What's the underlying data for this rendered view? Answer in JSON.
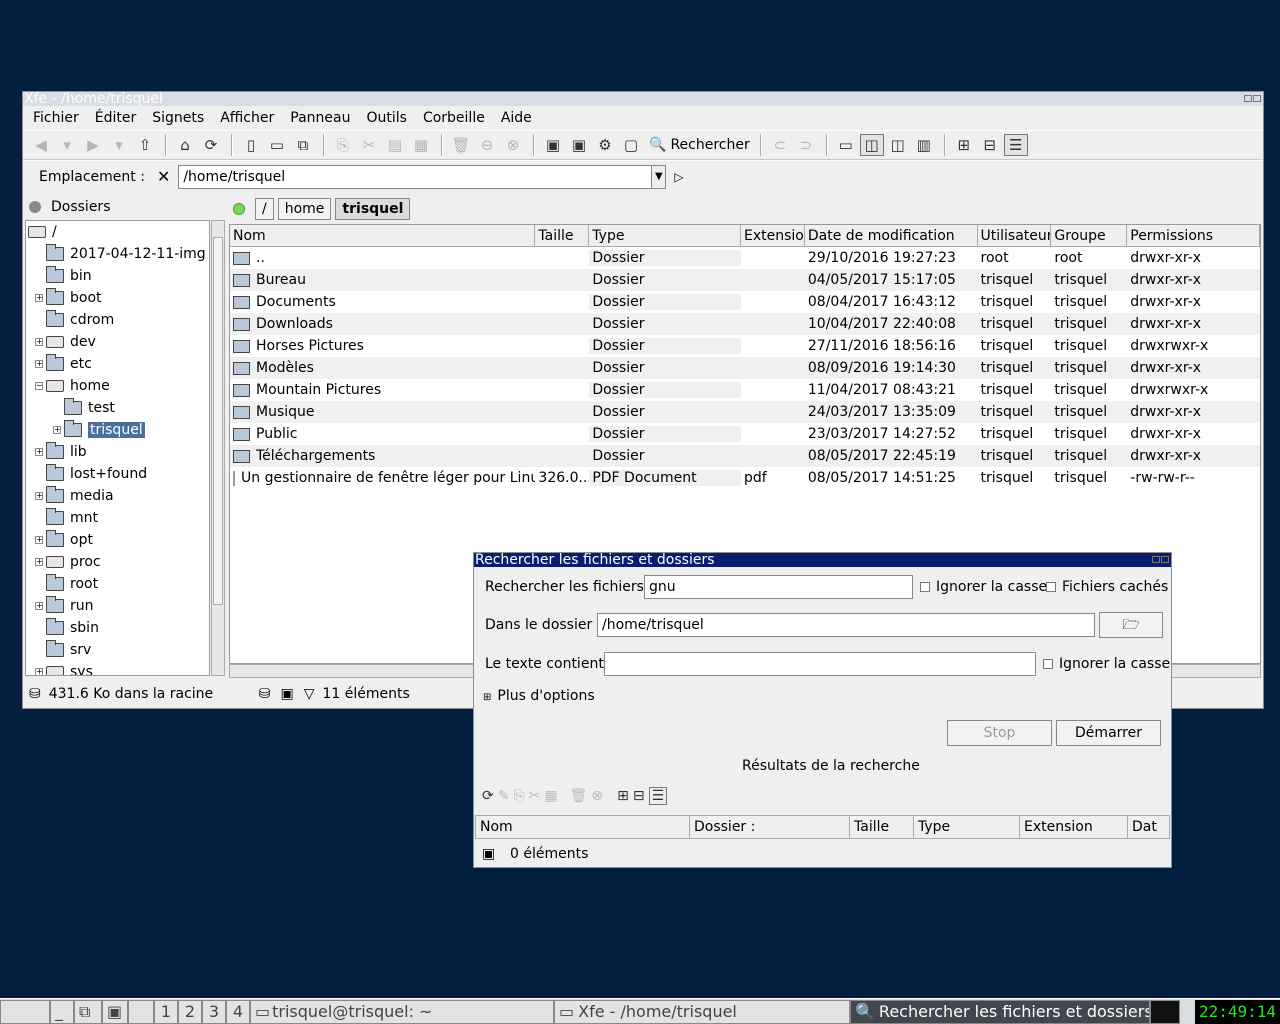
{
  "xfe": {
    "title": "Xfe - /home/trisquel",
    "menu": [
      "Fichier",
      "Éditer",
      "Signets",
      "Afficher",
      "Panneau",
      "Outils",
      "Corbeille",
      "Aide"
    ],
    "search_button": "Rechercher",
    "location_label": "Emplacement :",
    "location_value": "/home/trisquel",
    "folders_label": "Dossiers",
    "tree": [
      {
        "label": "/",
        "icon": "drive-icon",
        "expander": ""
      },
      {
        "label": "2017-04-12-11-img",
        "icon": "folder-icon",
        "expander": ""
      },
      {
        "label": "bin",
        "icon": "folder-icon",
        "expander": ""
      },
      {
        "label": "boot",
        "icon": "folder-icon",
        "expander": "+"
      },
      {
        "label": "cdrom",
        "icon": "folder-icon",
        "expander": ""
      },
      {
        "label": "dev",
        "icon": "drive-icon",
        "expander": "+"
      },
      {
        "label": "etc",
        "icon": "folder-icon",
        "expander": "+"
      },
      {
        "label": "home",
        "icon": "drive-icon",
        "expander": "−"
      },
      {
        "label": "test",
        "icon": "folder-icon",
        "expander": ""
      },
      {
        "label": "trisquel",
        "icon": "folder-icon",
        "expander": "+"
      },
      {
        "label": "lib",
        "icon": "folder-icon",
        "expander": "+"
      },
      {
        "label": "lost+found",
        "icon": "locked-folder-icon",
        "expander": ""
      },
      {
        "label": "media",
        "icon": "folder-icon",
        "expander": "+"
      },
      {
        "label": "mnt",
        "icon": "folder-icon",
        "expander": ""
      },
      {
        "label": "opt",
        "icon": "folder-icon",
        "expander": "+"
      },
      {
        "label": "proc",
        "icon": "drive-icon",
        "expander": "+"
      },
      {
        "label": "root",
        "icon": "locked-folder-icon",
        "expander": ""
      },
      {
        "label": "run",
        "icon": "folder-icon",
        "expander": "+"
      },
      {
        "label": "sbin",
        "icon": "folder-icon",
        "expander": ""
      },
      {
        "label": "srv",
        "icon": "folder-icon",
        "expander": ""
      },
      {
        "label": "sys",
        "icon": "drive-icon",
        "expander": "+"
      }
    ],
    "breadcrumb": [
      "/",
      "home",
      "trisquel"
    ],
    "columns": [
      "Nom",
      "Taille",
      "Type",
      "Extension",
      "Date de modification",
      "Utilisateur",
      "Groupe",
      "Permissions"
    ],
    "files": [
      {
        "name": "..",
        "size": "",
        "type": "Dossier",
        "ext": "",
        "date": "29/10/2016 19:27:23",
        "user": "root",
        "group": "root",
        "perm": "drwxr-xr-x"
      },
      {
        "name": "Bureau",
        "size": "",
        "type": "Dossier",
        "ext": "",
        "date": "04/05/2017 15:17:05",
        "user": "trisquel",
        "group": "trisquel",
        "perm": "drwxr-xr-x"
      },
      {
        "name": "Documents",
        "size": "",
        "type": "Dossier",
        "ext": "",
        "date": "08/04/2017 16:43:12",
        "user": "trisquel",
        "group": "trisquel",
        "perm": "drwxr-xr-x"
      },
      {
        "name": "Downloads",
        "size": "",
        "type": "Dossier",
        "ext": "",
        "date": "10/04/2017 22:40:08",
        "user": "trisquel",
        "group": "trisquel",
        "perm": "drwxr-xr-x"
      },
      {
        "name": "Horses Pictures",
        "size": "",
        "type": "Dossier",
        "ext": "",
        "date": "27/11/2016 18:56:16",
        "user": "trisquel",
        "group": "trisquel",
        "perm": "drwxrwxr-x"
      },
      {
        "name": "Modèles",
        "size": "",
        "type": "Dossier",
        "ext": "",
        "date": "08/09/2016 19:14:30",
        "user": "trisquel",
        "group": "trisquel",
        "perm": "drwxr-xr-x"
      },
      {
        "name": "Mountain Pictures",
        "size": "",
        "type": "Dossier",
        "ext": "",
        "date": "11/04/2017 08:43:21",
        "user": "trisquel",
        "group": "trisquel",
        "perm": "drwxrwxr-x"
      },
      {
        "name": "Musique",
        "size": "",
        "type": "Dossier",
        "ext": "",
        "date": "24/03/2017 13:35:09",
        "user": "trisquel",
        "group": "trisquel",
        "perm": "drwxr-xr-x"
      },
      {
        "name": "Public",
        "size": "",
        "type": "Dossier",
        "ext": "",
        "date": "23/03/2017 14:27:52",
        "user": "trisquel",
        "group": "trisquel",
        "perm": "drwxr-xr-x"
      },
      {
        "name": "Téléchargements",
        "size": "",
        "type": "Dossier",
        "ext": "",
        "date": "08/05/2017 22:45:19",
        "user": "trisquel",
        "group": "trisquel",
        "perm": "drwxr-xr-x"
      },
      {
        "name": "Un gestionnaire de fenêtre léger pour Linu...",
        "size": "326.0...",
        "type": "PDF Document",
        "ext": "pdf",
        "date": "08/05/2017 14:51:25",
        "user": "trisquel",
        "group": "trisquel",
        "perm": "-rw-rw-r--"
      }
    ],
    "status_root": "431.6 Ko dans la racine",
    "status_items": "11 éléments"
  },
  "search": {
    "title": "Rechercher les fichiers et dossiers",
    "files_label": "Rechercher les fichiers :",
    "files_value": "gnu",
    "ignore_case": "Ignorer la casse",
    "hidden_files": "Fichiers cachés",
    "folder_label": "Dans le dossier :",
    "folder_value": "/home/trisquel",
    "text_label": "Le texte contient :",
    "text_value": "",
    "text_ignore_case": "Ignorer la casse",
    "more_options": "Plus d'options",
    "stop": "Stop",
    "start": "Démarrer",
    "results_label": "Résultats de la recherche",
    "columns": [
      "Nom",
      "Dossier :",
      "Taille",
      "Type",
      "Extension",
      "Dat"
    ],
    "status": "0 éléments"
  },
  "taskbar": {
    "workspaces": [
      "1",
      "2",
      "3",
      "4"
    ],
    "tasks": [
      "trisquel@trisquel: ~",
      "Xfe - /home/trisquel",
      "Rechercher les fichiers et dossiers"
    ],
    "clock": "22:49:14"
  }
}
